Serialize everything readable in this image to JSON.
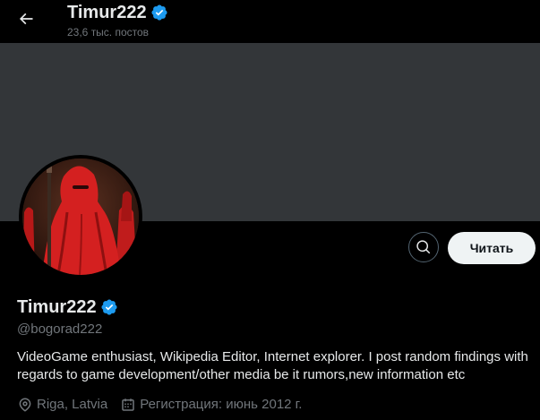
{
  "header": {
    "title": "Timur222",
    "posts_count": "23,6 тыс. постов"
  },
  "profile": {
    "name": "Timur222",
    "handle": "@bogorad222",
    "bio": "VideoGame enthusiast, Wikipedia Editor, Internet explorer. I post random findings with regards to game development/other media be it rumors,new information etc",
    "location": "Riga, Latvia",
    "joined": "Регистрация: июнь 2012 г."
  },
  "actions": {
    "follow_label": "Читать"
  },
  "icons": {
    "back": "arrow-left-icon",
    "verified": "verified-badge-icon",
    "search": "search-icon",
    "location": "location-pin-icon",
    "calendar": "calendar-icon"
  },
  "colors": {
    "background": "#000000",
    "banner": "#333639",
    "verified": "#1d9bf0",
    "muted_text": "#71767b",
    "button_bg": "#eff3f4"
  }
}
